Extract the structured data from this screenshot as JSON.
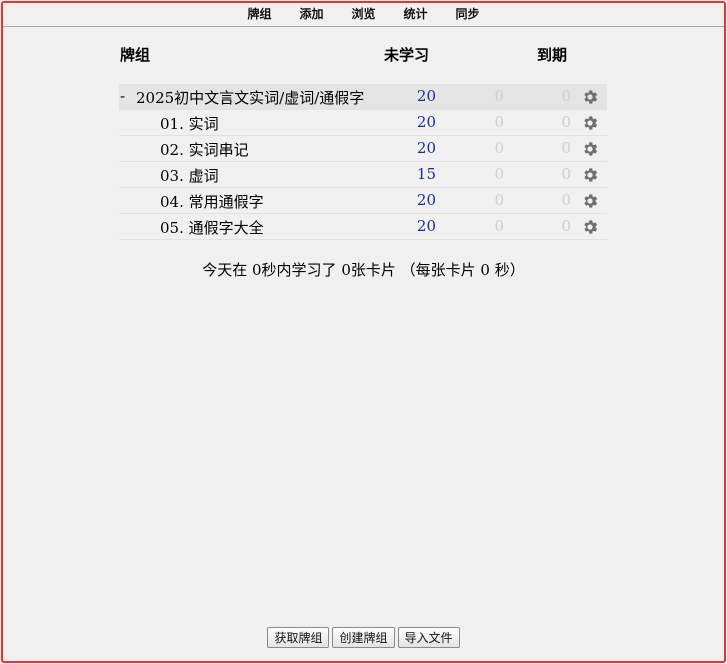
{
  "topbar": {
    "links": [
      "牌组",
      "添加",
      "浏览",
      "统计",
      "同步"
    ]
  },
  "table_header": {
    "deck": "牌组",
    "new": "未学习",
    "due": "到期"
  },
  "decks": [
    {
      "name": "2025初中文言文实词/虚词/通假字",
      "collapse": "-",
      "new": "20",
      "learn": "0",
      "due": "0",
      "level": 0,
      "current": true
    },
    {
      "name": "01. 实词",
      "collapse": "",
      "new": "20",
      "learn": "0",
      "due": "0",
      "level": 1,
      "current": false
    },
    {
      "name": "02. 实词串记",
      "collapse": "",
      "new": "20",
      "learn": "0",
      "due": "0",
      "level": 1,
      "current": false
    },
    {
      "name": "03. 虚词",
      "collapse": "",
      "new": "15",
      "learn": "0",
      "due": "0",
      "level": 1,
      "current": false
    },
    {
      "name": "04. 常用通假字",
      "collapse": "",
      "new": "20",
      "learn": "0",
      "due": "0",
      "level": 1,
      "current": false
    },
    {
      "name": "05. 通假字大全",
      "collapse": "",
      "new": "20",
      "learn": "0",
      "due": "0",
      "level": 1,
      "current": false
    }
  ],
  "stats_text": "今天在 0秒内学习了 0张卡片 （每张卡片 0 秒）",
  "bottom_buttons": {
    "get_shared": "获取牌组",
    "create_deck": "创建牌组",
    "import_file": "导入文件"
  },
  "colors": {
    "new_count": "#1e2a9a",
    "zero_count": "#cfcfcf",
    "frame": "#e8332e",
    "gear": "#6f6f6f"
  },
  "icons": {
    "options": "gear-icon"
  }
}
